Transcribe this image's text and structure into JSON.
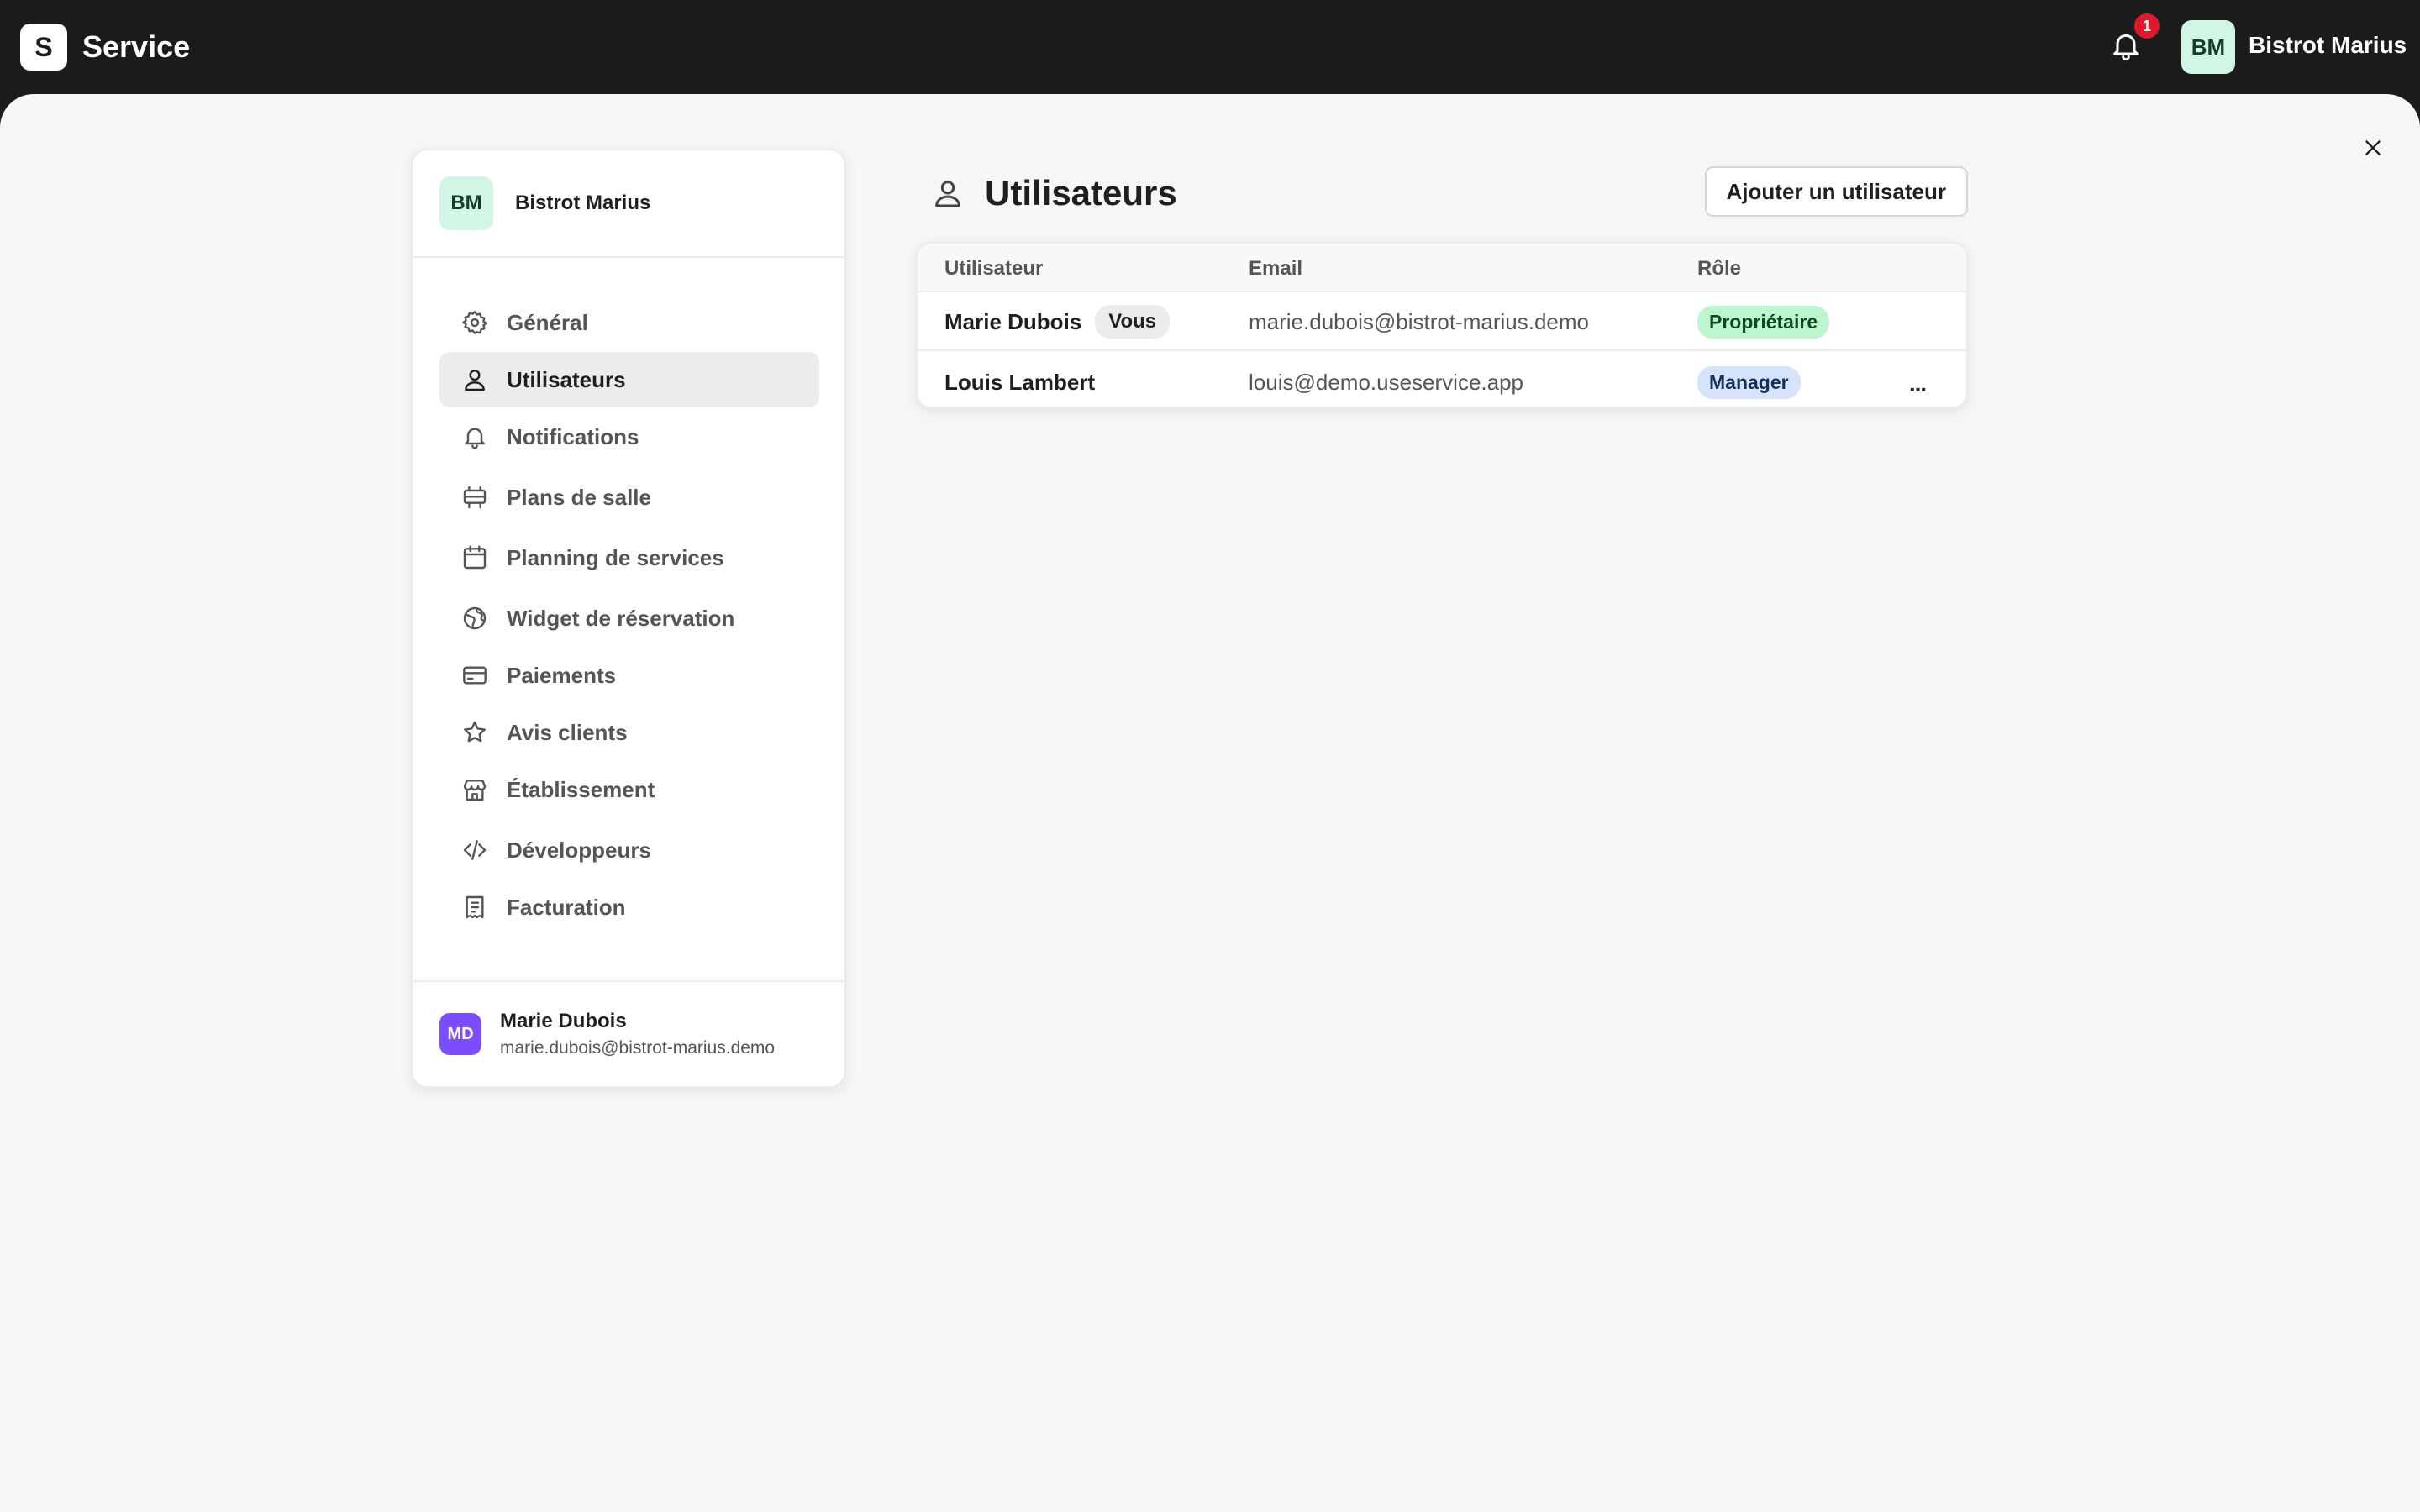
{
  "app": {
    "logo_letter": "S",
    "name": "Service",
    "notification_count": "1",
    "account_initials": "BM",
    "account_name": "Bistrot Marius"
  },
  "sidebar": {
    "org_initials": "BM",
    "org_name": "Bistrot Marius",
    "items": [
      {
        "label": "Général",
        "icon": "gear-icon"
      },
      {
        "label": "Utilisateurs",
        "icon": "user-icon",
        "active": true
      },
      {
        "label": "Notifications",
        "icon": "bell-icon"
      },
      {
        "label": "Plans de salle",
        "icon": "floor-plan-icon"
      },
      {
        "label": "Planning de services",
        "icon": "calendar-icon"
      },
      {
        "label": "Widget de réservation",
        "icon": "globe-icon"
      },
      {
        "label": "Paiements",
        "icon": "credit-card-icon"
      },
      {
        "label": "Avis clients",
        "icon": "star-icon"
      },
      {
        "label": "Établissement",
        "icon": "store-icon"
      },
      {
        "label": "Développeurs",
        "icon": "code-icon"
      },
      {
        "label": "Facturation",
        "icon": "receipt-icon"
      }
    ],
    "user": {
      "initials": "MD",
      "name": "Marie Dubois",
      "email": "marie.dubois@bistrot-marius.demo"
    }
  },
  "main": {
    "title": "Utilisateurs",
    "add_button": "Ajouter un utilisateur",
    "columns": [
      "Utilisateur",
      "Email",
      "Rôle"
    ],
    "rows": [
      {
        "name": "Marie Dubois",
        "you_badge": "Vous",
        "email": "marie.dubois@bistrot-marius.demo",
        "role": "Propriétaire"
      },
      {
        "name": "Louis Lambert",
        "email": "louis@demo.useservice.app",
        "role": "Manager",
        "menu": "..."
      }
    ]
  },
  "colors": {
    "topbar": "#1b1b1b",
    "owner_badge": "#bdf5cf",
    "manager_badge": "#d6e4fb",
    "notification_badge": "#e0182d",
    "user_avatar": "#7c4dff"
  }
}
